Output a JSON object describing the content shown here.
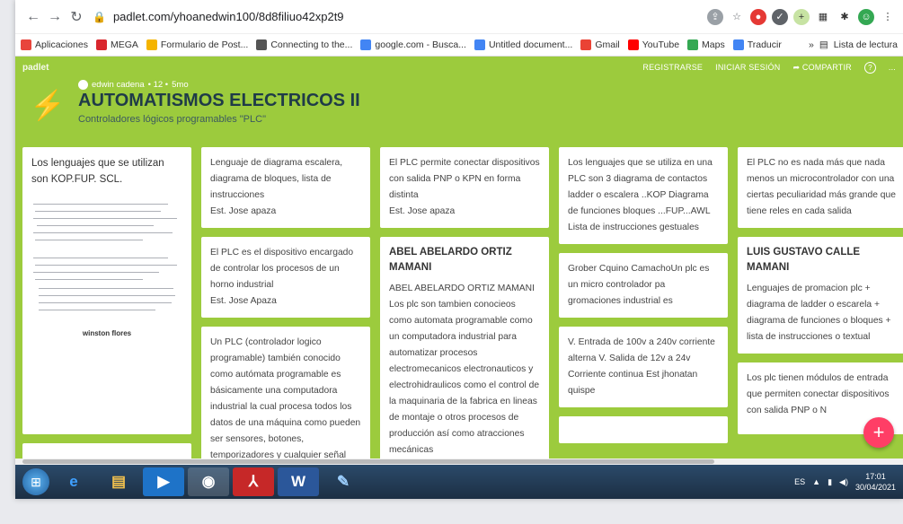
{
  "browser": {
    "url": "padlet.com/yhoanedwin100/8d8filiuo42xp2t9",
    "bookmarks": [
      {
        "label": "Aplicaciones",
        "color": "#e8453c"
      },
      {
        "label": "MEGA",
        "color": "#d9272e"
      },
      {
        "label": "Formulario de Post...",
        "color": "#f5b400"
      },
      {
        "label": "Connecting to the...",
        "color": "#555555"
      },
      {
        "label": "google.com - Busca...",
        "color": "#4285f4"
      },
      {
        "label": "Untitled document...",
        "color": "#4285f4"
      },
      {
        "label": "Gmail",
        "color": "#ea4335"
      },
      {
        "label": "YouTube",
        "color": "#ff0000"
      },
      {
        "label": "Maps",
        "color": "#34a853"
      },
      {
        "label": "Traducir",
        "color": "#4285f4"
      }
    ],
    "bookmarks_more": "»",
    "reading_list": "Lista de lectura"
  },
  "padlet": {
    "brand": "padlet",
    "actions": {
      "register": "REGISTRARSE",
      "login": "INICIAR SESIÓN",
      "share": "COMPARTIR",
      "help": "?",
      "more": "..."
    },
    "author": "edwin cadena",
    "likes": "• 12 •",
    "age": "5mo",
    "title": "AUTOMATISMOS ELECTRICOS II",
    "subtitle": "Controladores lógicos programables \"PLC\"",
    "accent": "#9ccb3d",
    "fab": "+"
  },
  "columns": [
    [
      {
        "title": "Los lenguajes que se utilizan son KOP.FUP. SCL.",
        "handwritten": true,
        "signature": "winston flores"
      },
      {
        "title": "",
        "body": ""
      }
    ],
    [
      {
        "body": "Lenguaje de diagrama escalera, diagrama de bloques, lista de instrucciones",
        "author": "Est. Jose apaza"
      },
      {
        "body": "El PLC es el dispositivo encargado de controlar los procesos de un horno industrial",
        "author": "Est. Jose Apaza"
      },
      {
        "body": "Un PLC (controlador logico programable) también conocido como autómata programable es básicamente una computadora industrial la cual procesa todos los datos de una máquina como pueden ser sensores, botones, temporizadores y cualquier señal"
      }
    ],
    [
      {
        "body": "El PLC permite conectar dispositivos con salida PNP o KPN en forma distinta",
        "author": "Est. Jose apaza"
      },
      {
        "title": "ABEL ABELARDO ORTIZ MAMANI",
        "body": "ABEL ABELARDO ORTIZ MAMANI Los plc son tambien conocieos como automata programable como un computadora industrial para automatizar procesos electromecanicos electronauticos y electrohidraulicos como el control de la maquinaria de la fabrica  en lineas de montaje o otros procesos de producción así como atracciones mecánicas"
      }
    ],
    [
      {
        "body": "Los lenguajes que se utiliza en una PLC son 3  diagrama de contactos ladder o escalera ..KOP Diagrama de funciones bloques ...FUP...AWL Lista de instrucciones gestuales"
      },
      {
        "body": "Grober Cquino CamachoUn plc  es un micro controlador    pa gromaciones  industrial es"
      },
      {
        "body": "V. Entrada de 100v a 240v corriente alterna V. Salida de 12v a 24v Corriente continua Est jhonatan quispe"
      },
      {
        "body": ""
      }
    ],
    [
      {
        "body": "El PLC no es nada más que nada menos un microcontrolador con una ciertas peculiaridad más grande que tiene reles en cada salida"
      },
      {
        "title": "LUIS GUSTAVO CALLE MAMANI",
        "body": "Lenguajes de promacion plc + diagrama de ladder o escarela + diagrama de funciones o bloques + lista de instrucciones o textual"
      },
      {
        "body": "Los  plc tienen módulos de entrada  que permiten conectar dispositivos con salida PNP o N"
      }
    ]
  ],
  "taskbar": {
    "lang": "ES",
    "time": "17:01",
    "date": "30/04/2021"
  }
}
